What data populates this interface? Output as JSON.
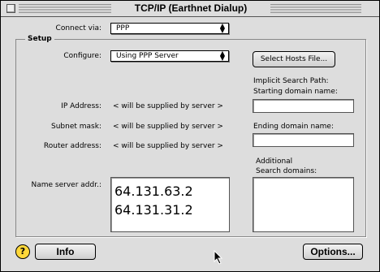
{
  "window": {
    "title": "TCP/IP (Earthnet Dialup)"
  },
  "connect": {
    "label": "Connect via:",
    "value": "PPP"
  },
  "setup": {
    "title": "Setup",
    "configure_label": "Configure:",
    "configure_value": "Using PPP Server",
    "select_hosts_button": "Select Hosts File...",
    "ip_label": "IP Address:",
    "ip_value": "< will be supplied by server >",
    "subnet_label": "Subnet mask:",
    "subnet_value": "< will be supplied by server >",
    "router_label": "Router address:",
    "router_value": "< will be supplied by server >",
    "name_server_label": "Name server addr.:",
    "name_servers": [
      "64.131.63.2",
      "64.131.31.2"
    ],
    "implicit_search_label_1": "Implicit Search Path:",
    "implicit_search_label_2": "Starting domain name:",
    "starting_domain_value": "",
    "ending_domain_label": "Ending domain name:",
    "ending_domain_value": "",
    "additional_label_1": "Additional",
    "additional_label_2": "Search domains:",
    "additional_value": ""
  },
  "footer": {
    "help_icon_glyph": "?",
    "info_button": "Info",
    "options_button": "Options..."
  },
  "icons": {
    "close": "close-box-icon",
    "help": "help-icon",
    "cursor": "arrow-cursor-icon"
  }
}
